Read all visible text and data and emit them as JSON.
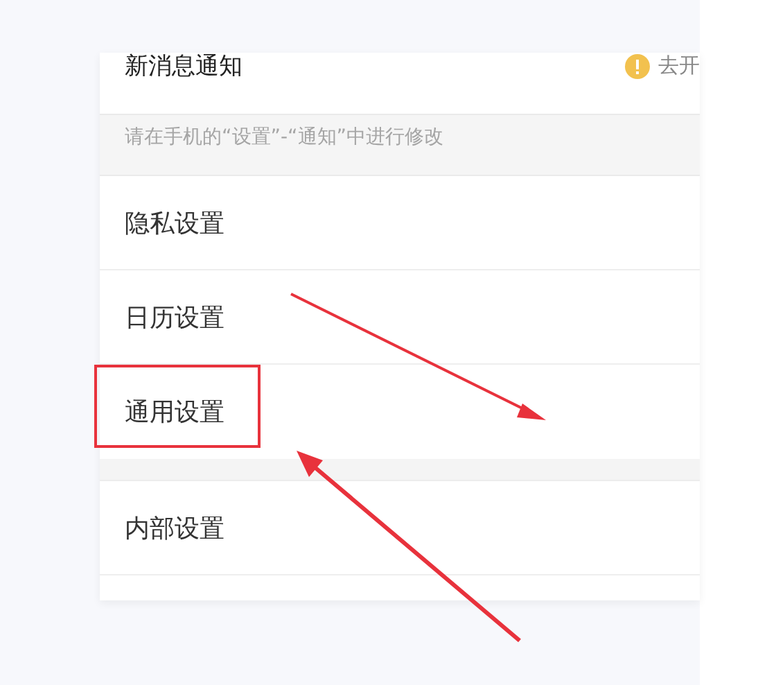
{
  "notification": {
    "title": "新消息通知",
    "action": "去开",
    "note": "请在手机的“设置”-“通知”中进行修改"
  },
  "groups": [
    {
      "items": [
        {
          "label": "隐私设置",
          "annotated": false
        },
        {
          "label": "日历设置",
          "annotated": false
        },
        {
          "label": "通用设置",
          "annotated": true
        }
      ]
    },
    {
      "items": [
        {
          "label": "内部设置",
          "annotated": false
        }
      ]
    }
  ]
}
